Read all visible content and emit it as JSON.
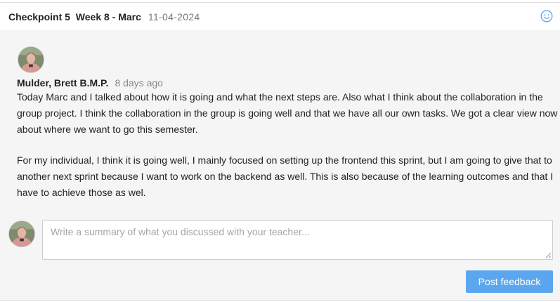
{
  "header": {
    "checkpoint": "Checkpoint 5",
    "week": "Week 8 - Marc",
    "date": "11-04-2024",
    "reaction_icon": "smiley-icon"
  },
  "comment": {
    "author": "Mulder, Brett B.M.P.",
    "time": "8 days ago",
    "paragraphs": [
      "Today Marc and I talked about how it is going and what the next steps are. Also what I think about the collaboration in the group project. I think the collaboration in the group is going well and that we have all our own tasks. We got a clear view now about where we want to go this semester.",
      "For my individual, I think it is going well, I mainly focused on setting up the frontend this sprint, but I am going to give that to another next sprint because I want to work on the backend as well. This is also because of the learning outcomes and that I have to achieve those as wel."
    ]
  },
  "feedback": {
    "placeholder": "Write a summary of what you discussed with your teacher...",
    "value": "",
    "submit_label": "Post feedback"
  },
  "colors": {
    "accent": "#5aa7f0",
    "background": "#f5f5f5",
    "muted_text": "#888888"
  }
}
